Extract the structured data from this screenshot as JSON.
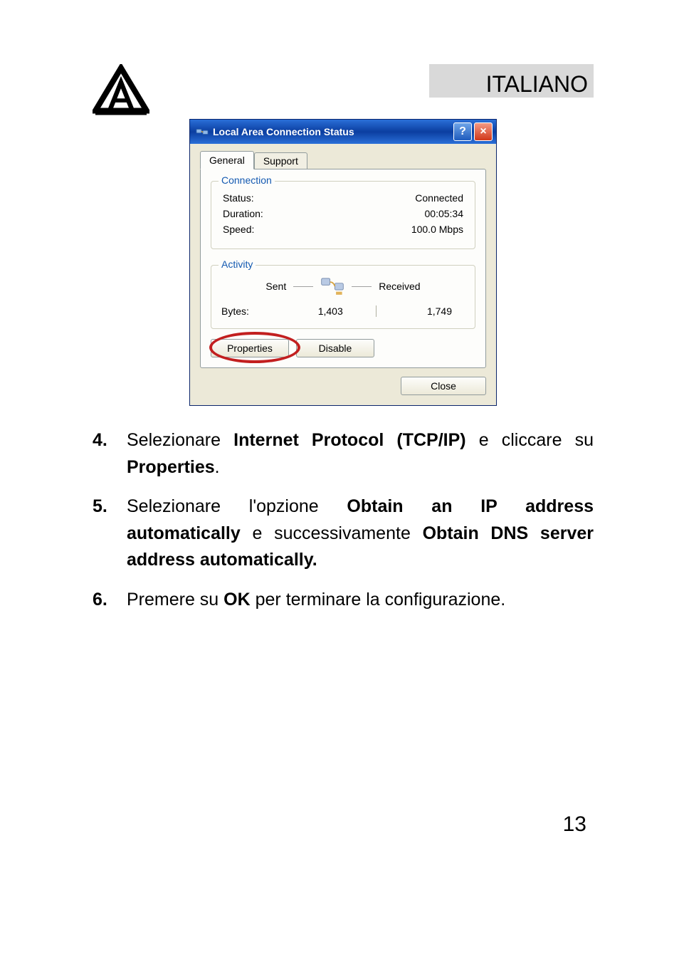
{
  "header": {
    "language": "ITALIANO"
  },
  "dialog": {
    "title": "Local Area Connection Status",
    "tabs": {
      "general": "General",
      "support": "Support"
    },
    "connection": {
      "legend": "Connection",
      "status_label": "Status:",
      "status_value": "Connected",
      "duration_label": "Duration:",
      "duration_value": "00:05:34",
      "speed_label": "Speed:",
      "speed_value": "100.0 Mbps"
    },
    "activity": {
      "legend": "Activity",
      "sent_label": "Sent",
      "received_label": "Received",
      "bytes_label": "Bytes:",
      "sent_value": "1,403",
      "received_value": "1,749"
    },
    "buttons": {
      "properties": "Properties",
      "disable": "Disable",
      "close": "Close"
    }
  },
  "instructions": [
    {
      "num": "4.",
      "html": "Selezionare <b>Internet Protocol (TCP/IP)</b> e cliccare su <b>Properties</b>."
    },
    {
      "num": "5.",
      "html": "Selezionare l'opzione <b>Obtain an IP address automatically</b> e successivamente <b>Obtain DNS server address automatically.</b>"
    },
    {
      "num": "6.",
      "html": "Premere su  <b>OK</b> per terminare la configurazione."
    }
  ],
  "page_number": "13"
}
